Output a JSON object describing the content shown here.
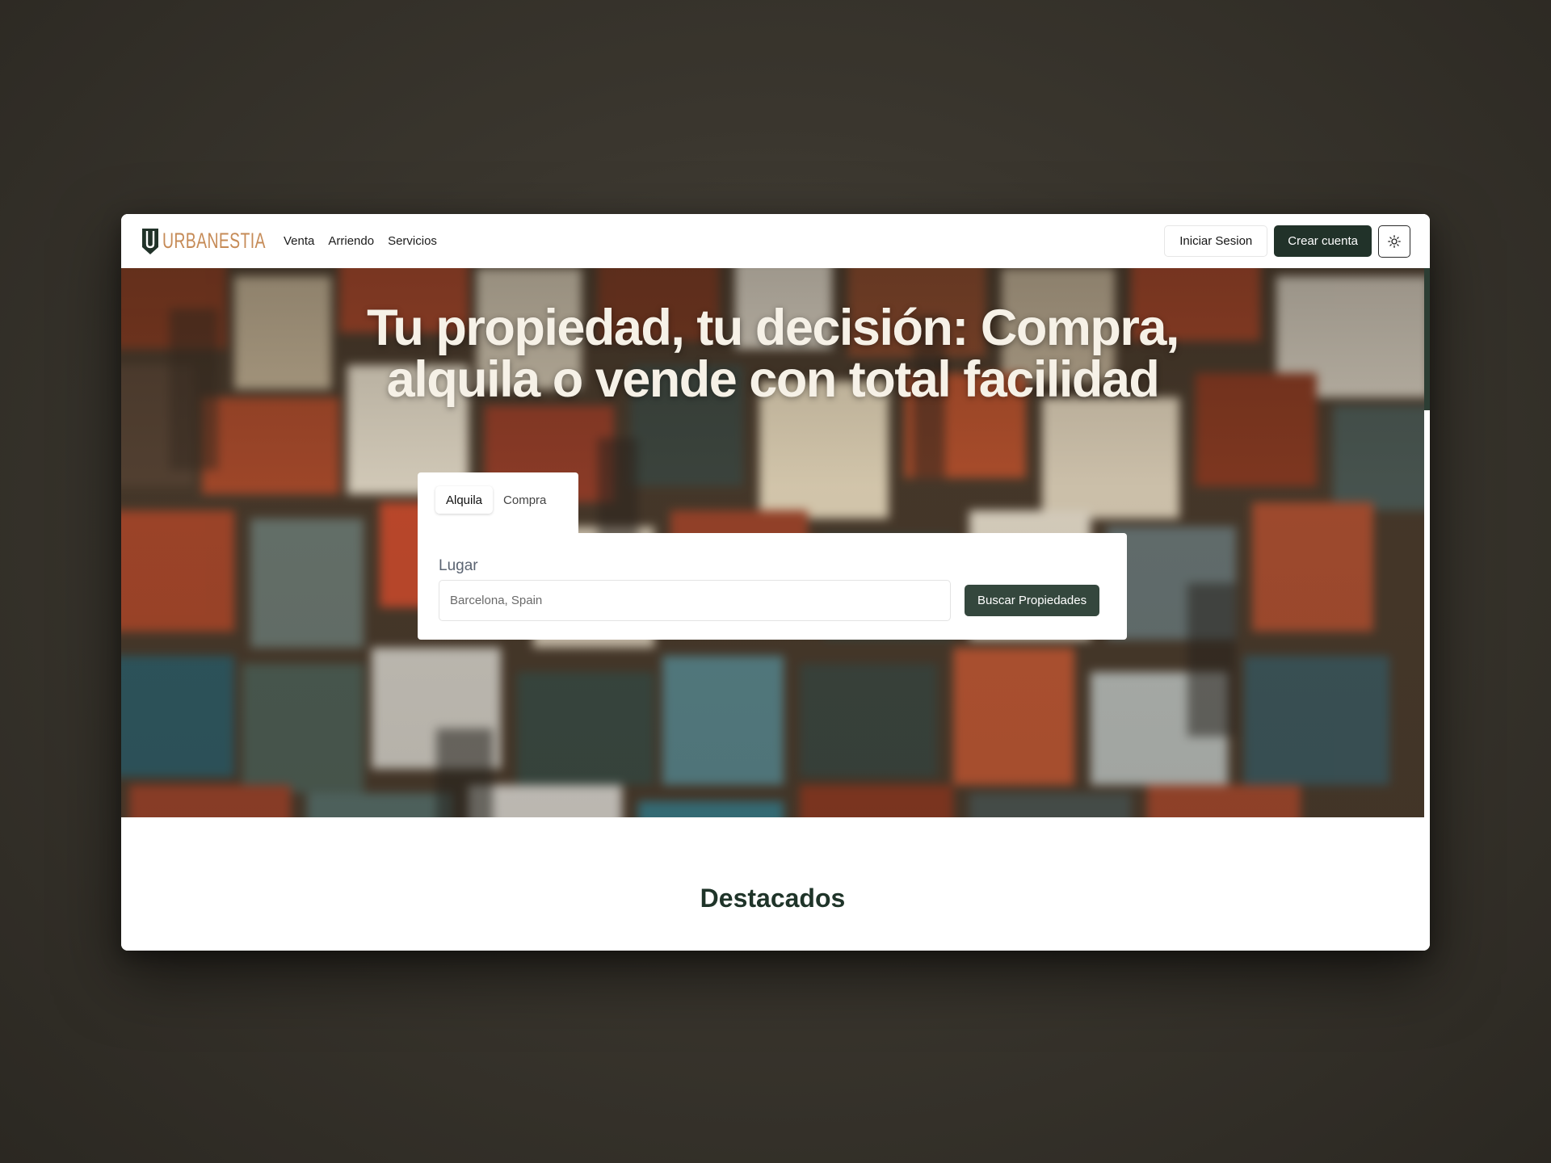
{
  "brand": {
    "name": "URBANESTIA",
    "logo_color": "#c68b57",
    "mark_color": "#213229"
  },
  "nav": {
    "links": [
      "Venta",
      "Arriendo",
      "Servicios"
    ]
  },
  "actions": {
    "login_label": "Iniciar Sesion",
    "signup_label": "Crear cuenta",
    "theme_icon": "sun-icon"
  },
  "hero": {
    "title_line1": "Tu propiedad, tu decisión: Compra,",
    "title_line2": "alquila o vende con total facilidad"
  },
  "search": {
    "tabs": [
      {
        "label": "Alquila",
        "active": true
      },
      {
        "label": "Compra",
        "active": false
      }
    ],
    "field_label": "Lugar",
    "placeholder": "Barcelona, Spain",
    "value": "",
    "submit_label": "Buscar Propiedades"
  },
  "featured": {
    "title": "Destacados"
  },
  "colors": {
    "primary": "#213229",
    "button": "#34473d",
    "heading": "#1f3429"
  }
}
